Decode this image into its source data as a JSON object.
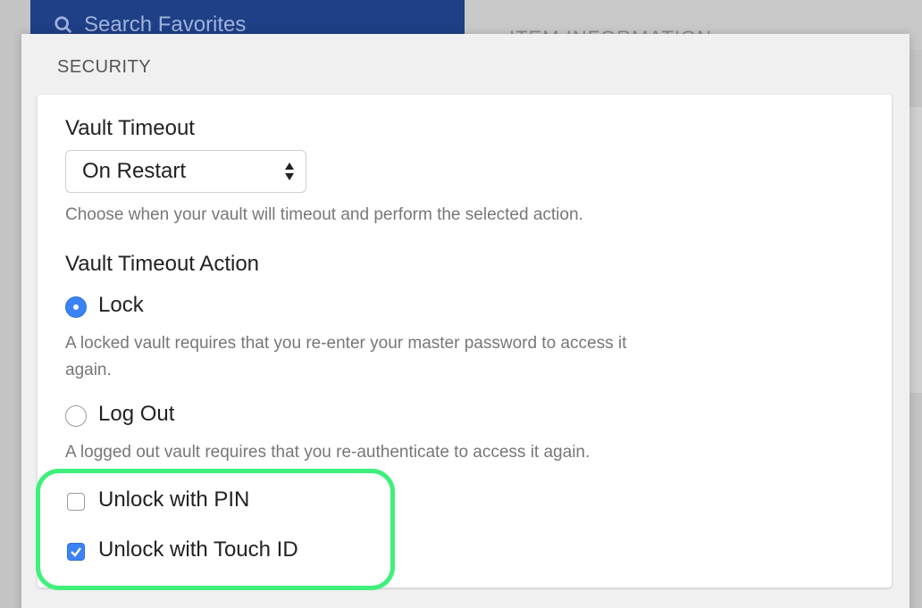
{
  "background": {
    "search_placeholder": "Search Favorites",
    "right_panel_heading": "ITEM INFORMATION"
  },
  "security": {
    "section_title": "SECURITY",
    "vault_timeout": {
      "label": "Vault Timeout",
      "selected": "On Restart",
      "help": "Choose when your vault will timeout and perform the selected action."
    },
    "timeout_action": {
      "label": "Vault Timeout Action",
      "options": [
        {
          "label": "Lock",
          "selected": true,
          "help_line1": "A locked vault requires that you re-enter your master password to access it",
          "help_line2": "again."
        },
        {
          "label": "Log Out",
          "selected": false,
          "help_line1": "A logged out vault requires that you re-authenticate to access it again."
        }
      ]
    },
    "unlock_options": [
      {
        "label": "Unlock with PIN",
        "checked": false
      },
      {
        "label": "Unlock with Touch ID",
        "checked": true
      }
    ]
  },
  "colors": {
    "accent": "#3b82f6",
    "highlight": "#3ef07a",
    "header_blue": "#1f3f86"
  }
}
